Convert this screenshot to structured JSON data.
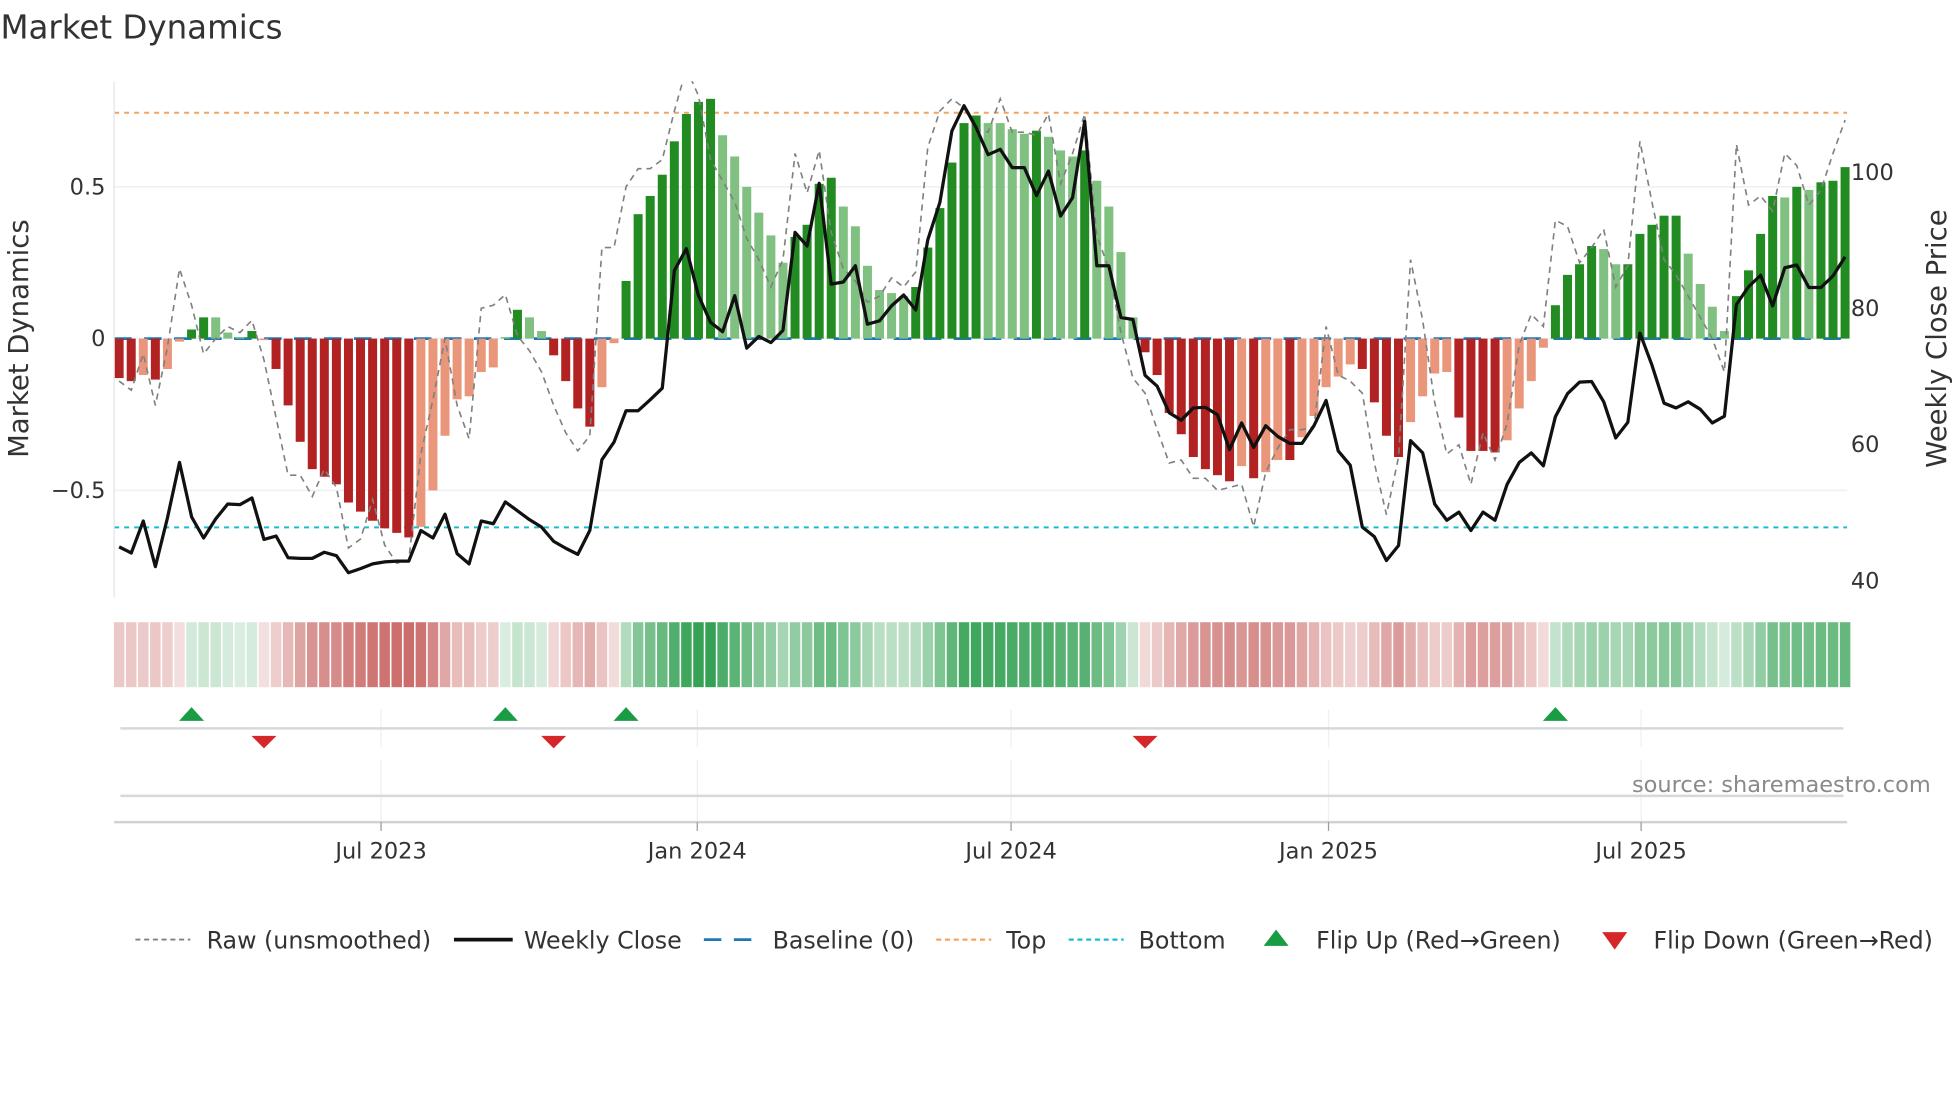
{
  "title": "Market Dynamics",
  "source": "source: sharemaestro.com",
  "chart_data": {
    "type": "bar",
    "title": "Market Dynamics",
    "ylabel": "Market Dynamics",
    "y2label": "Weekly Close Price",
    "ylim": [
      -0.852,
      0.848
    ],
    "y2lim": [
      37.4,
      113.2
    ],
    "yticks": [
      {
        "v": 0.5,
        "label": "0.5"
      },
      {
        "v": 0,
        "label": "0"
      },
      {
        "v": -0.5,
        "label": "−0.5"
      }
    ],
    "y2ticks": [
      {
        "v": 100,
        "label": "100"
      },
      {
        "v": 80,
        "label": "80"
      },
      {
        "v": 60,
        "label": "60"
      },
      {
        "v": 40,
        "label": "40"
      }
    ],
    "x_unit": "week index",
    "xticks": [
      {
        "week": 21.7,
        "label": "Jul 2023"
      },
      {
        "week": 47.9,
        "label": "Jan 2024"
      },
      {
        "week": 73.9,
        "label": "Jul 2024"
      },
      {
        "week": 100.2,
        "label": "Jan 2025"
      },
      {
        "week": 126.1,
        "label": "Jul 2025"
      }
    ],
    "top_level": 0.744,
    "bottom_level": -0.622,
    "baseline": 0,
    "colors": {
      "pos_strong": "#228b22",
      "pos_weak": "#80c080",
      "neg_strong": "#b22222",
      "neg_weak": "#e9967a",
      "raw": "#808080",
      "close": "#111111",
      "baseline": "#1f77b4",
      "top": "#f4a460",
      "bottom": "#17becf",
      "heat_pos": "#2e9e4f",
      "heat_neg": "#c0504d",
      "flip_up": "#1a9c45",
      "flip_down": "#d62728"
    },
    "values": [
      -0.13,
      -0.14,
      -0.12,
      -0.135,
      -0.1,
      -0.01,
      0.03,
      0.07,
      0.07,
      0.02,
      0.005,
      0.025,
      -0.005,
      -0.1,
      -0.22,
      -0.34,
      -0.43,
      -0.455,
      -0.48,
      -0.54,
      -0.57,
      -0.6,
      -0.625,
      -0.64,
      -0.655,
      -0.62,
      -0.5,
      -0.32,
      -0.2,
      -0.19,
      -0.11,
      -0.095,
      0.005,
      0.095,
      0.07,
      0.025,
      -0.055,
      -0.14,
      -0.23,
      -0.29,
      -0.16,
      -0.015,
      0.19,
      0.41,
      0.47,
      0.54,
      0.65,
      0.74,
      0.78,
      0.79,
      0.67,
      0.6,
      0.5,
      0.415,
      0.34,
      0.25,
      0.335,
      0.375,
      0.51,
      0.53,
      0.435,
      0.37,
      0.24,
      0.16,
      0.15,
      0.14,
      0.17,
      0.3,
      0.43,
      0.58,
      0.71,
      0.735,
      0.71,
      0.71,
      0.69,
      0.675,
      0.685,
      0.665,
      0.62,
      0.6,
      0.62,
      0.52,
      0.435,
      0.285,
      0.07,
      -0.045,
      -0.12,
      -0.245,
      -0.315,
      -0.39,
      -0.43,
      -0.45,
      -0.47,
      -0.42,
      -0.46,
      -0.44,
      -0.4,
      -0.4,
      -0.325,
      -0.255,
      -0.16,
      -0.125,
      -0.085,
      -0.1,
      -0.21,
      -0.32,
      -0.39,
      -0.275,
      -0.19,
      -0.115,
      -0.11,
      -0.26,
      -0.37,
      -0.37,
      -0.375,
      -0.335,
      -0.23,
      -0.14,
      -0.03,
      0.11,
      0.21,
      0.245,
      0.305,
      0.295,
      0.245,
      0.245,
      0.345,
      0.375,
      0.405,
      0.405,
      0.28,
      0.18,
      0.105,
      0.025,
      0.14,
      0.225,
      0.345,
      0.47,
      0.465,
      0.5,
      0.49,
      0.515,
      0.52,
      0.565
    ],
    "strength": "SSWSWWSSWWWSWSSSSSSSSSSSSWWWWWWWWSWWSSSSWWSSSSSSSSWWWWWWSSSSWWWWWWSSSSSSWWWWSWWWSWWWWSSSSSSSSWSWWSWWWWWSSSSWWWWSSSSWWWWSSSSWWSSSSSWWWWSSSSWSWSSS",
    "raw": [
      -0.14,
      -0.17,
      -0.05,
      -0.22,
      -0.03,
      0.23,
      0.11,
      -0.05,
      0.0,
      0.04,
      0.02,
      0.06,
      -0.07,
      -0.26,
      -0.45,
      -0.45,
      -0.52,
      -0.43,
      -0.49,
      -0.69,
      -0.66,
      -0.53,
      -0.68,
      -0.74,
      -0.73,
      -0.38,
      -0.2,
      0.0,
      -0.22,
      -0.33,
      0.1,
      0.11,
      0.145,
      0.01,
      -0.04,
      -0.11,
      -0.22,
      -0.31,
      -0.37,
      -0.32,
      0.3,
      0.3,
      0.5,
      0.56,
      0.56,
      0.59,
      0.75,
      0.89,
      0.8,
      0.59,
      0.52,
      0.45,
      0.33,
      0.26,
      0.17,
      0.26,
      0.61,
      0.48,
      0.62,
      0.35,
      0.23,
      0.19,
      0.12,
      0.14,
      0.2,
      0.17,
      0.22,
      0.63,
      0.75,
      0.79,
      0.76,
      0.69,
      0.68,
      0.79,
      0.68,
      0.68,
      0.67,
      0.74,
      0.51,
      0.61,
      0.74,
      0.34,
      0.23,
      0.02,
      -0.13,
      -0.18,
      -0.3,
      -0.41,
      -0.4,
      -0.46,
      -0.46,
      -0.5,
      -0.49,
      -0.48,
      -0.62,
      -0.44,
      -0.36,
      -0.3,
      -0.3,
      -0.29,
      0.04,
      -0.12,
      -0.14,
      -0.18,
      -0.41,
      -0.58,
      -0.39,
      0.26,
      0.06,
      -0.21,
      -0.38,
      -0.35,
      -0.48,
      -0.31,
      -0.4,
      -0.28,
      -0.02,
      0.08,
      0.04,
      0.39,
      0.37,
      0.25,
      0.3,
      0.36,
      0.17,
      0.24,
      0.65,
      0.45,
      0.26,
      0.21,
      0.14,
      0.07,
      0.0,
      -0.11,
      0.64,
      0.44,
      0.47,
      0.42,
      0.61,
      0.57,
      0.44,
      0.49,
      0.61,
      0.72
    ],
    "close": [
      44.8,
      43.9,
      48.6,
      41.9,
      49.0,
      57.2,
      49.2,
      46.1,
      48.9,
      51.1,
      51.0,
      52.0,
      45.9,
      46.4,
      43.2,
      43.1,
      43.1,
      44.0,
      43.5,
      41.0,
      41.6,
      42.3,
      42.6,
      42.7,
      42.7,
      47.2,
      46.1,
      49.6,
      43.8,
      42.3,
      48.6,
      48.2,
      51.4,
      50.1,
      48.8,
      47.7,
      45.6,
      44.6,
      43.7,
      47.2,
      57.6,
      60.2,
      64.8,
      64.8,
      66.4,
      68.1,
      85.4,
      88.6,
      81.7,
      77.8,
      76.4,
      81.7,
      74.0,
      75.7,
      74.8,
      76.6,
      91.0,
      89.0,
      98.2,
      83.4,
      83.7,
      86.1,
      77.5,
      78.0,
      80.2,
      81.8,
      79.6,
      89.9,
      95.4,
      105.9,
      109.6,
      106.4,
      102.4,
      103.2,
      100.5,
      100.5,
      96.4,
      100.0,
      93.4,
      96.1,
      107.3,
      86.1,
      86.1,
      78.5,
      78.2,
      70.0,
      68.4,
      64.5,
      63.4,
      65.2,
      65.3,
      64.2,
      59.1,
      63.0,
      59.4,
      62.6,
      61.0,
      60.0,
      60.0,
      62.6,
      66.3,
      58.9,
      56.8,
      47.7,
      46.3,
      42.8,
      45.0,
      60.4,
      58.6,
      51.1,
      48.7,
      49.9,
      47.2,
      49.9,
      48.7,
      54.0,
      57.2,
      58.6,
      56.7,
      63.9,
      67.3,
      69.0,
      69.1,
      66.1,
      60.8,
      63.1,
      76.2,
      71.5,
      65.9,
      65.2,
      66.1,
      65.0,
      63.0,
      64.0,
      80.4,
      83.0,
      84.7,
      80.2,
      85.8,
      86.2,
      82.9,
      82.9,
      84.6,
      87.4
    ],
    "flip_up_weeks": [
      6,
      32,
      42,
      119
    ],
    "flip_down_weeks": [
      12,
      36,
      85
    ],
    "legend": {
      "placement": "bottom",
      "items": [
        {
          "key": "raw",
          "label": "Raw (unsmoothed)"
        },
        {
          "key": "close",
          "label": "Weekly Close"
        },
        {
          "key": "baseline",
          "label": "Baseline (0)"
        },
        {
          "key": "top",
          "label": "Top"
        },
        {
          "key": "bottom",
          "label": "Bottom"
        },
        {
          "key": "flip_up",
          "label": "Flip Up (Red→Green)"
        },
        {
          "key": "flip_down",
          "label": "Flip Down (Green→Red)"
        }
      ]
    }
  }
}
